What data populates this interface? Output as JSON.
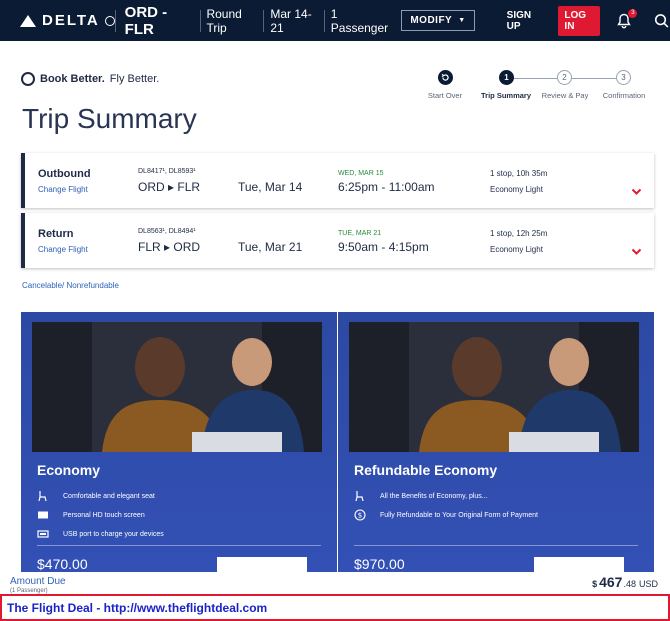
{
  "header": {
    "logo_text": "DELTA",
    "route": "ORD - FLR",
    "trip_type": "Round Trip",
    "dates": "Mar 14-21",
    "passengers": "1 Passenger",
    "modify_label": "MODIFY",
    "signup_label": "SIGN UP",
    "login_label": "LOG IN",
    "notification_count": "3"
  },
  "brand": {
    "book": "Book Better.",
    "fly": "Fly Better."
  },
  "stepper": {
    "steps": [
      {
        "label": "Start Over",
        "number": "",
        "state": "done"
      },
      {
        "label": "Trip Summary",
        "number": "1",
        "state": "active"
      },
      {
        "label": "Review & Pay",
        "number": "2",
        "state": "pending"
      },
      {
        "label": "Confirmation",
        "number": "3",
        "state": "pending"
      }
    ]
  },
  "page_title": "Trip Summary",
  "flights": [
    {
      "direction": "Outbound",
      "change_label": "Change Flight",
      "flight_numbers": "DL8417¹, DL8593¹",
      "route": "ORD ▸ FLR",
      "date": "Tue, Mar 14",
      "arrival_date": "WED, MAR 15",
      "times": "6:25pm - 11:00am",
      "stops": "1 stop, 10h 35m",
      "cabin": "Economy Light"
    },
    {
      "direction": "Return",
      "change_label": "Change Flight",
      "flight_numbers": "DL8563¹, DL8494¹",
      "route": "FLR ▸ ORD",
      "date": "Tue, Mar 21",
      "arrival_date": "TUE, MAR 21",
      "times": "9:50am - 4:15pm",
      "stops": "1 stop, 12h 25m",
      "cabin": "Economy Light"
    }
  ],
  "cancel_note": "Cancelable/ Nonrefundable",
  "fares": [
    {
      "title": "Economy",
      "features": [
        {
          "icon": "seat-icon",
          "text": "Comfortable and elegant seat"
        },
        {
          "icon": "screen-icon",
          "text": "Personal HD touch screen"
        },
        {
          "icon": "usb-icon",
          "text": "USB port to charge your devices"
        }
      ],
      "price_partial": "$470.00"
    },
    {
      "title": "Refundable Economy",
      "features": [
        {
          "icon": "seat-icon",
          "text": "All the Benefits of Economy, plus..."
        },
        {
          "icon": "dollar-icon",
          "text": "Fully Refundable to Your Original Form of Payment"
        }
      ],
      "price_partial": "$970.00"
    }
  ],
  "amount_due": {
    "label": "Amount Due",
    "sub": "(1 Passenger)",
    "currency_symbol": "$",
    "dollars": "467",
    "cents": ".48",
    "currency": "USD"
  },
  "footer_text": "The Flight Deal - http://www.theflightdeal.com",
  "colors": {
    "navy": "#0b1b34",
    "red": "#e01933",
    "link_blue": "#2f62b8",
    "card_blue": "#3350b5",
    "arrival_green": "#2a8a3a"
  }
}
